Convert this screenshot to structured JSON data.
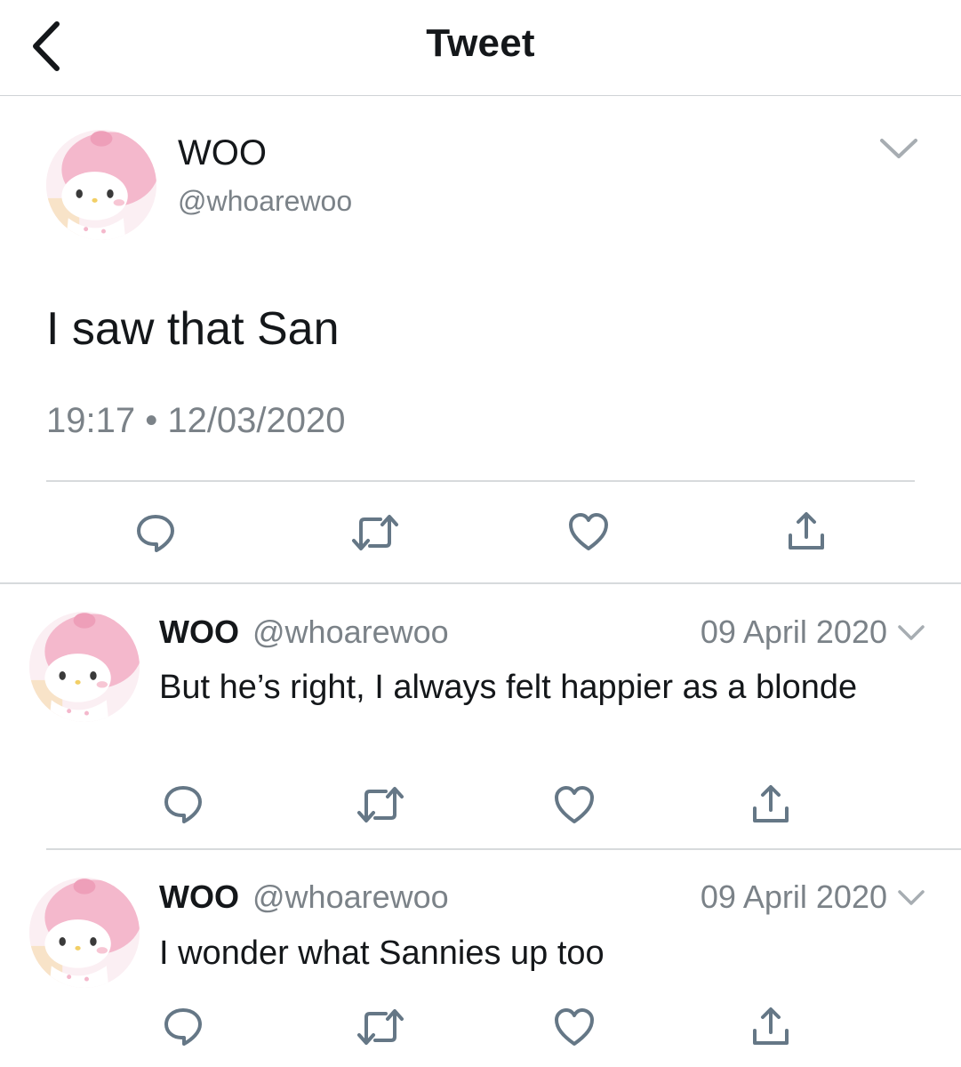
{
  "header": {
    "title": "Tweet",
    "back_icon": "chevron-left-icon"
  },
  "main_tweet": {
    "display_name": "WOO",
    "handle": "@whoarewoo",
    "text": "I saw that San",
    "timestamp": "19:17 • 12/03/2020",
    "icons": [
      "reply-icon",
      "retweet-icon",
      "like-icon",
      "share-icon"
    ]
  },
  "replies": [
    {
      "display_name": "WOO",
      "handle": "@whoarewoo",
      "date": "09 April 2020",
      "text": "But he’s right, I always felt happier as a blonde"
    },
    {
      "display_name": "WOO",
      "handle": "@whoarewoo",
      "date": "09 April 2020",
      "text": "I wonder what Sannies up too"
    }
  ],
  "colors": {
    "text": "#14171a",
    "secondary": "#7b8288",
    "icon": "#657786",
    "divider": "#d7dadc",
    "avatar_pink": "#f4b8cc"
  }
}
